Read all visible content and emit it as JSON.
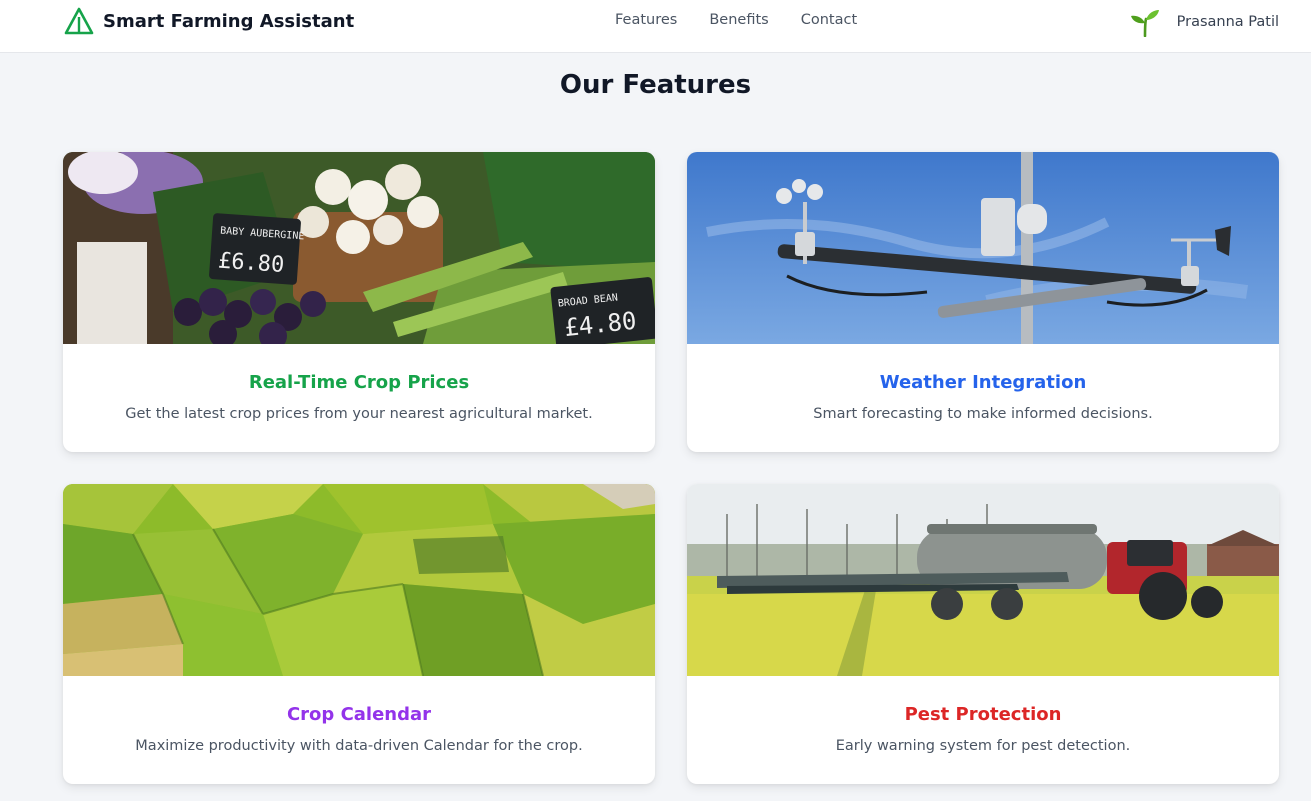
{
  "header": {
    "brand": "Smart Farming Assistant",
    "nav": [
      "Features",
      "Benefits",
      "Contact"
    ],
    "user_name": "Prasanna Patil",
    "logo_icon": "triangle-logo-icon",
    "user_icon": "sprout-icon"
  },
  "section": {
    "title": "Our Features"
  },
  "cards": [
    {
      "title": "Real-Time Crop Prices",
      "description": "Get the latest crop prices from your nearest agricultural market.",
      "title_color": "#16a34a",
      "image": "vegetable-market-photo",
      "image_labels": [
        "BABY AUBERGINE",
        "£6.80",
        "BROAD BEAN",
        "£4.80"
      ]
    },
    {
      "title": "Weather Integration",
      "description": "Smart forecasting to make informed decisions.",
      "title_color": "#2563eb",
      "image": "weather-station-photo"
    },
    {
      "title": "Crop Calendar",
      "description": "Maximize productivity with data-driven Calendar for the crop.",
      "title_color": "#9333ea",
      "image": "aerial-fields-photo"
    },
    {
      "title": "Pest Protection",
      "description": "Early warning system for pest detection.",
      "title_color": "#dc2626",
      "image": "tractor-sprayer-photo"
    }
  ],
  "colors": {
    "brand_green": "#16a34a",
    "page_bg": "#f3f5f8"
  }
}
